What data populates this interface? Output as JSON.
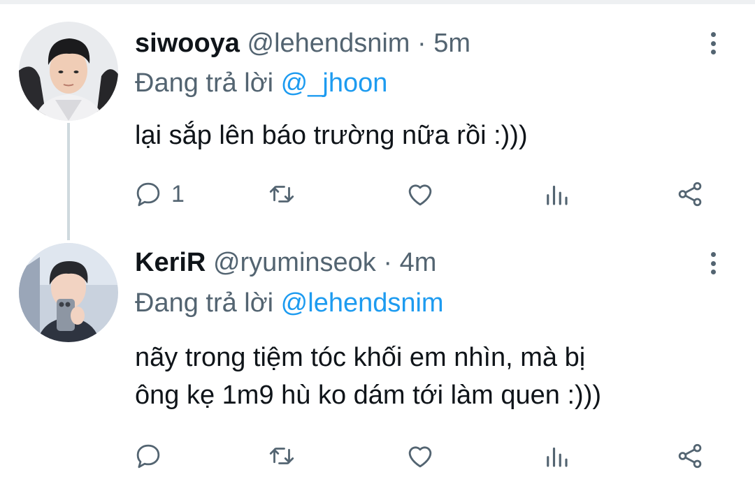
{
  "tweets": [
    {
      "name": "siwooya",
      "handle": "@lehendsnim",
      "separator": "·",
      "time": "5m",
      "replying_prefix": "Đang trả lời",
      "replying_to": "@_jhoon",
      "text_lines": [
        "lại sắp lên báo trường nữa rồi :)))"
      ],
      "reply_count": "1"
    },
    {
      "name": "KeriR",
      "handle": "@ryuminseok",
      "separator": "·",
      "time": "4m",
      "replying_prefix": "Đang trả lời",
      "replying_to": "@lehendsnim",
      "text_lines": [
        "nãy trong tiệm tóc khối em nhìn, mà bị",
        "ông kẹ 1m9 hù ko dám tới làm quen :)))"
      ],
      "reply_count": ""
    }
  ],
  "icons": [
    "more-vertical-icon",
    "reply-icon",
    "retweet-icon",
    "like-icon",
    "views-icon",
    "share-icon"
  ],
  "colors": {
    "text": "#0f1419",
    "secondary": "#536471",
    "link": "#1d9bf0",
    "thread_line": "#cfd9de"
  }
}
